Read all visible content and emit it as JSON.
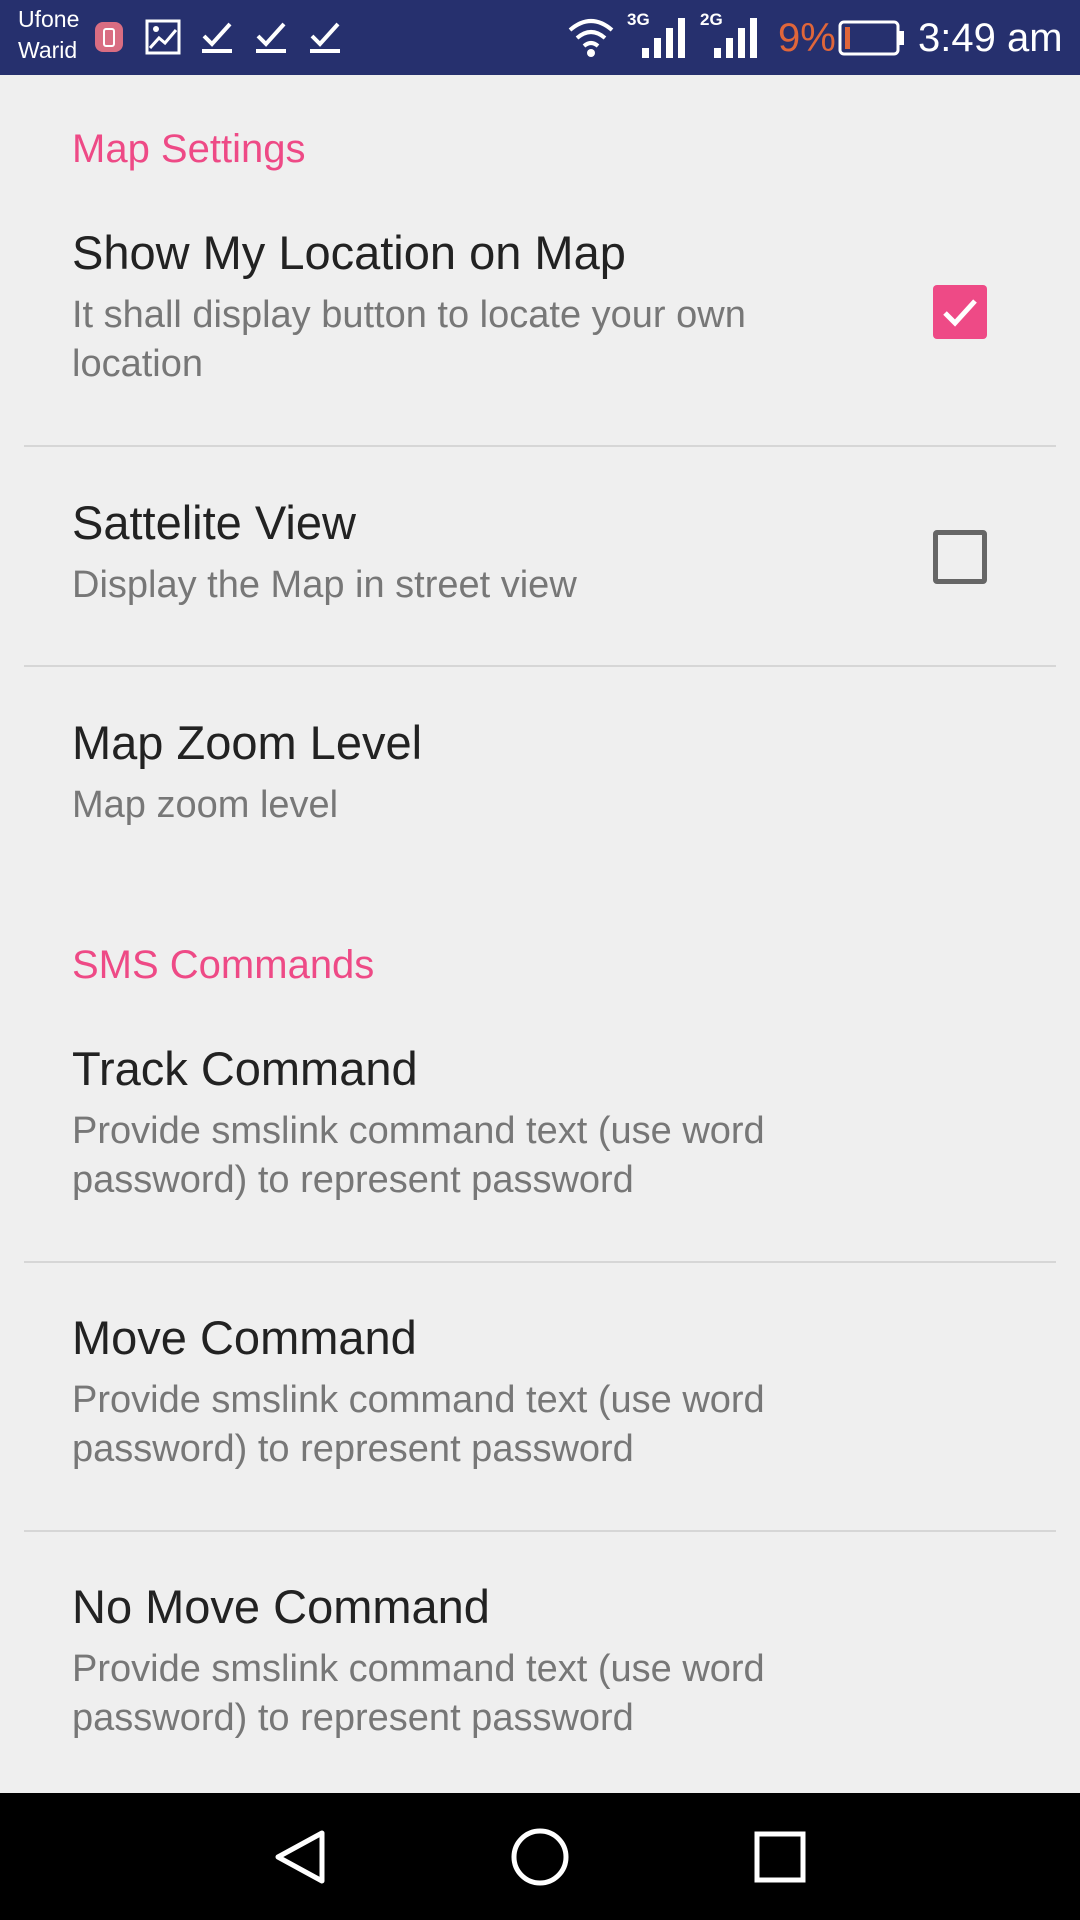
{
  "status_bar": {
    "carrier_line1": "Ufone",
    "carrier_line2": "Warid",
    "network1": "3G",
    "network2": "2G",
    "battery_percent": "9%",
    "time": "3:49 am"
  },
  "sections": {
    "map_settings": {
      "header": "Map Settings",
      "show_location": {
        "title": "Show My Location on Map",
        "summary": "It shall display button to locate your own location",
        "checked": true
      },
      "satellite_view": {
        "title": "Sattelite View",
        "summary": "Display the Map in street view",
        "checked": false
      },
      "zoom_level": {
        "title": "Map Zoom Level",
        "summary": "Map zoom level"
      }
    },
    "sms_commands": {
      "header": "SMS Commands",
      "track": {
        "title": "Track Command",
        "summary": "Provide smslink command text (use word password) to represent password"
      },
      "move": {
        "title": "Move Command",
        "summary": "Provide smslink command text (use word password) to represent password"
      },
      "no_move": {
        "title": "No Move Command",
        "summary": "Provide smslink command text (use word password) to represent password"
      }
    }
  },
  "colors": {
    "status_bar": "#26306e",
    "accent": "#ee4a86",
    "battery_low": "#e0663a"
  }
}
